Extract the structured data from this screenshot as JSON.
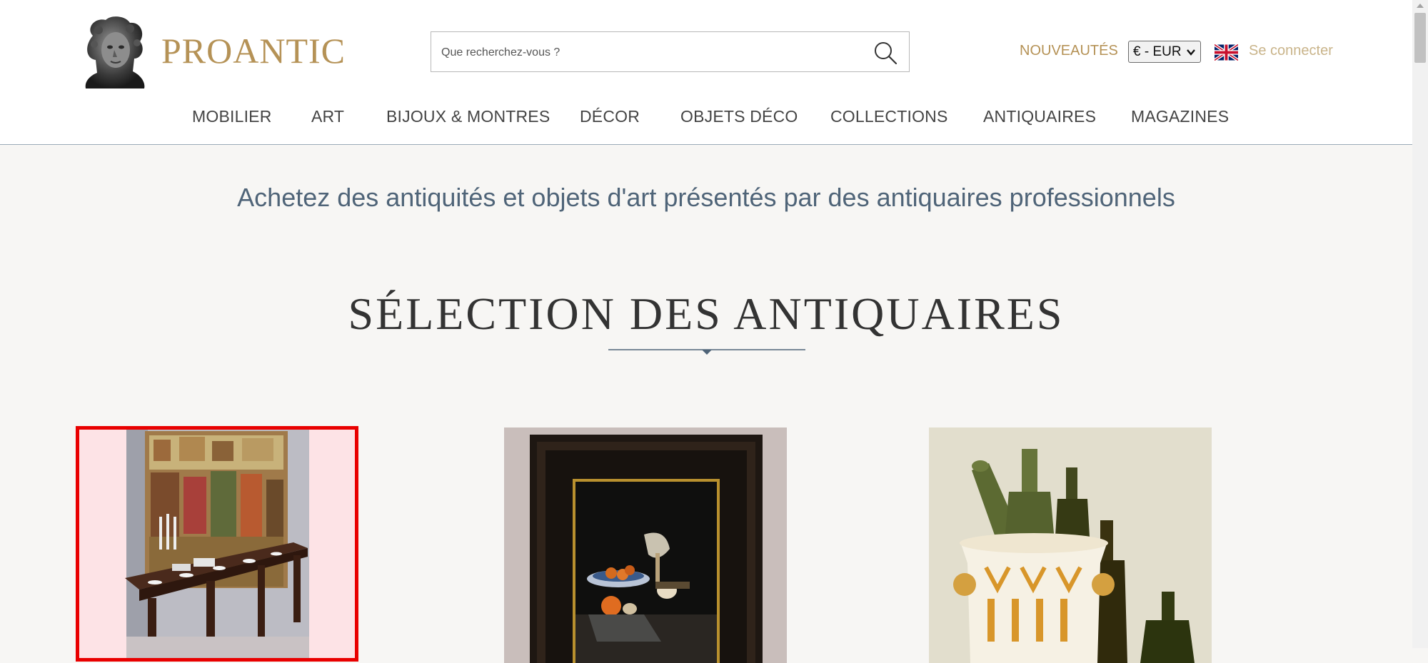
{
  "header": {
    "brand": "PROANTIC",
    "search_placeholder": "Que recherchez-vous ?",
    "nouveautes": "NOUVEAUTÉS",
    "currency": "€ - EUR",
    "login": "Se connecter",
    "language_flag": "uk-flag-icon",
    "logo_icon": "cherub-bust-logo"
  },
  "nav": {
    "items": [
      "MOBILIER",
      "ART",
      "BIJOUX & MONTRES",
      "DÉCOR",
      "OBJETS DÉCO",
      "COLLECTIONS",
      "ANTIQUAIRES",
      "MAGAZINES"
    ]
  },
  "main": {
    "tagline": "Achetez des antiquités et objets d'art présentés par des antiquaires professionnels",
    "section_title": "SÉLECTION DES ANTIQUAIRES",
    "cards": [
      {
        "image": "dining-table-tapestry-photo",
        "selected": true
      },
      {
        "image": "still-life-painting-photo",
        "selected": false
      },
      {
        "image": "wine-bottles-cooler-photo",
        "selected": false
      }
    ]
  },
  "colors": {
    "gold": "#b59256",
    "login_gold": "#c9b48a",
    "tagline_blue": "#4f6478",
    "selection_red": "#e90000",
    "background": "#f7f6f4"
  }
}
